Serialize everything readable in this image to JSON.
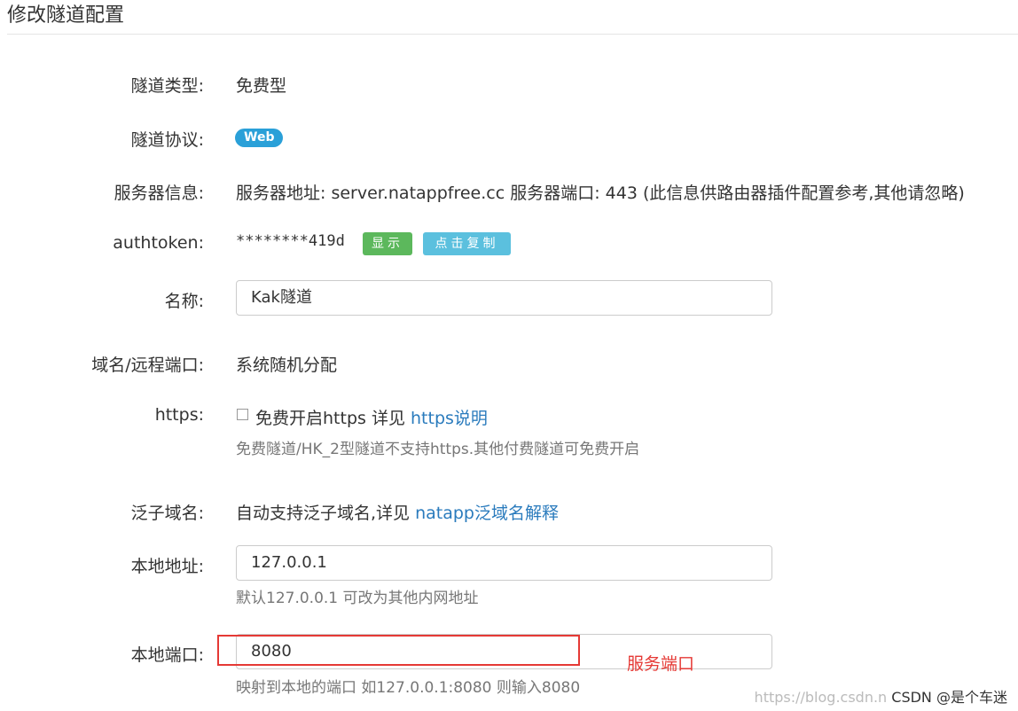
{
  "page_title": "修改隧道配置",
  "fields": {
    "tunnel_type": {
      "label": "隧道类型:",
      "value": "免费型"
    },
    "protocol": {
      "label": "隧道协议:",
      "badge": "Web"
    },
    "server_info": {
      "label": "服务器信息:",
      "value": "服务器地址: server.natappfree.cc 服务器端口: 443 (此信息供路由器插件配置参考,其他请忽略)"
    },
    "authtoken": {
      "label": "authtoken:",
      "value": "********419d",
      "show_button": "显示",
      "copy_button": "点击复制"
    },
    "name": {
      "label": "名称:",
      "value": "Kak隧道"
    },
    "domain_port": {
      "label": "域名/远程端口:",
      "value": "系统随机分配"
    },
    "https": {
      "label": "https:",
      "checkbox_text": "免费开启https 详见",
      "link": "https说明",
      "help": "免费隧道/HK_2型隧道不支持https.其他付费隧道可免费开启"
    },
    "wildcard": {
      "label": "泛子域名:",
      "text": "自动支持泛子域名,详见",
      "link": "natapp泛域名解释"
    },
    "local_address": {
      "label": "本地地址:",
      "value": "127.0.0.1",
      "help": "默认127.0.0.1 可改为其他内网地址"
    },
    "local_port": {
      "label": "本地端口:",
      "value": "8080",
      "help": "映射到本地的端口 如127.0.0.1:8080 则输入8080"
    }
  },
  "annotation": "服务端口",
  "watermark": {
    "url": "https://blog.csdn.n",
    "brand": "CSDN @是个车迷"
  },
  "colors": {
    "badge": "#2aa0d8",
    "show_button": "#5cb85c",
    "copy_button": "#5bc0de",
    "link": "#2a7bbd",
    "annotation": "#e53935"
  }
}
